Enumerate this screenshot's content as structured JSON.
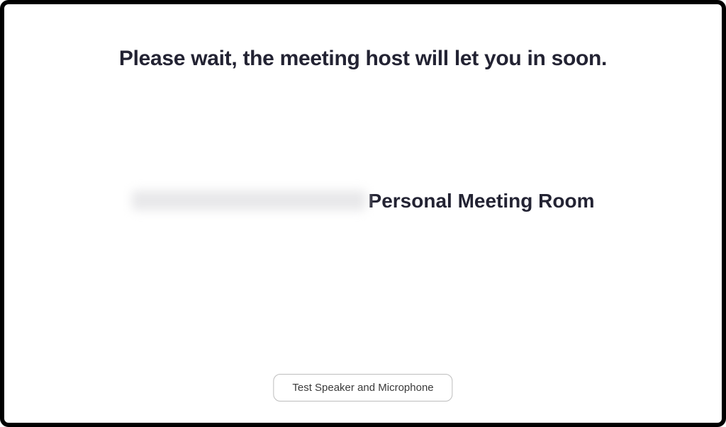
{
  "waiting": {
    "message": "Please wait, the meeting host will let you in soon."
  },
  "meeting": {
    "host_name_redacted": true,
    "title_suffix": "Personal Meeting Room"
  },
  "controls": {
    "test_audio_label": "Test Speaker and Microphone"
  }
}
